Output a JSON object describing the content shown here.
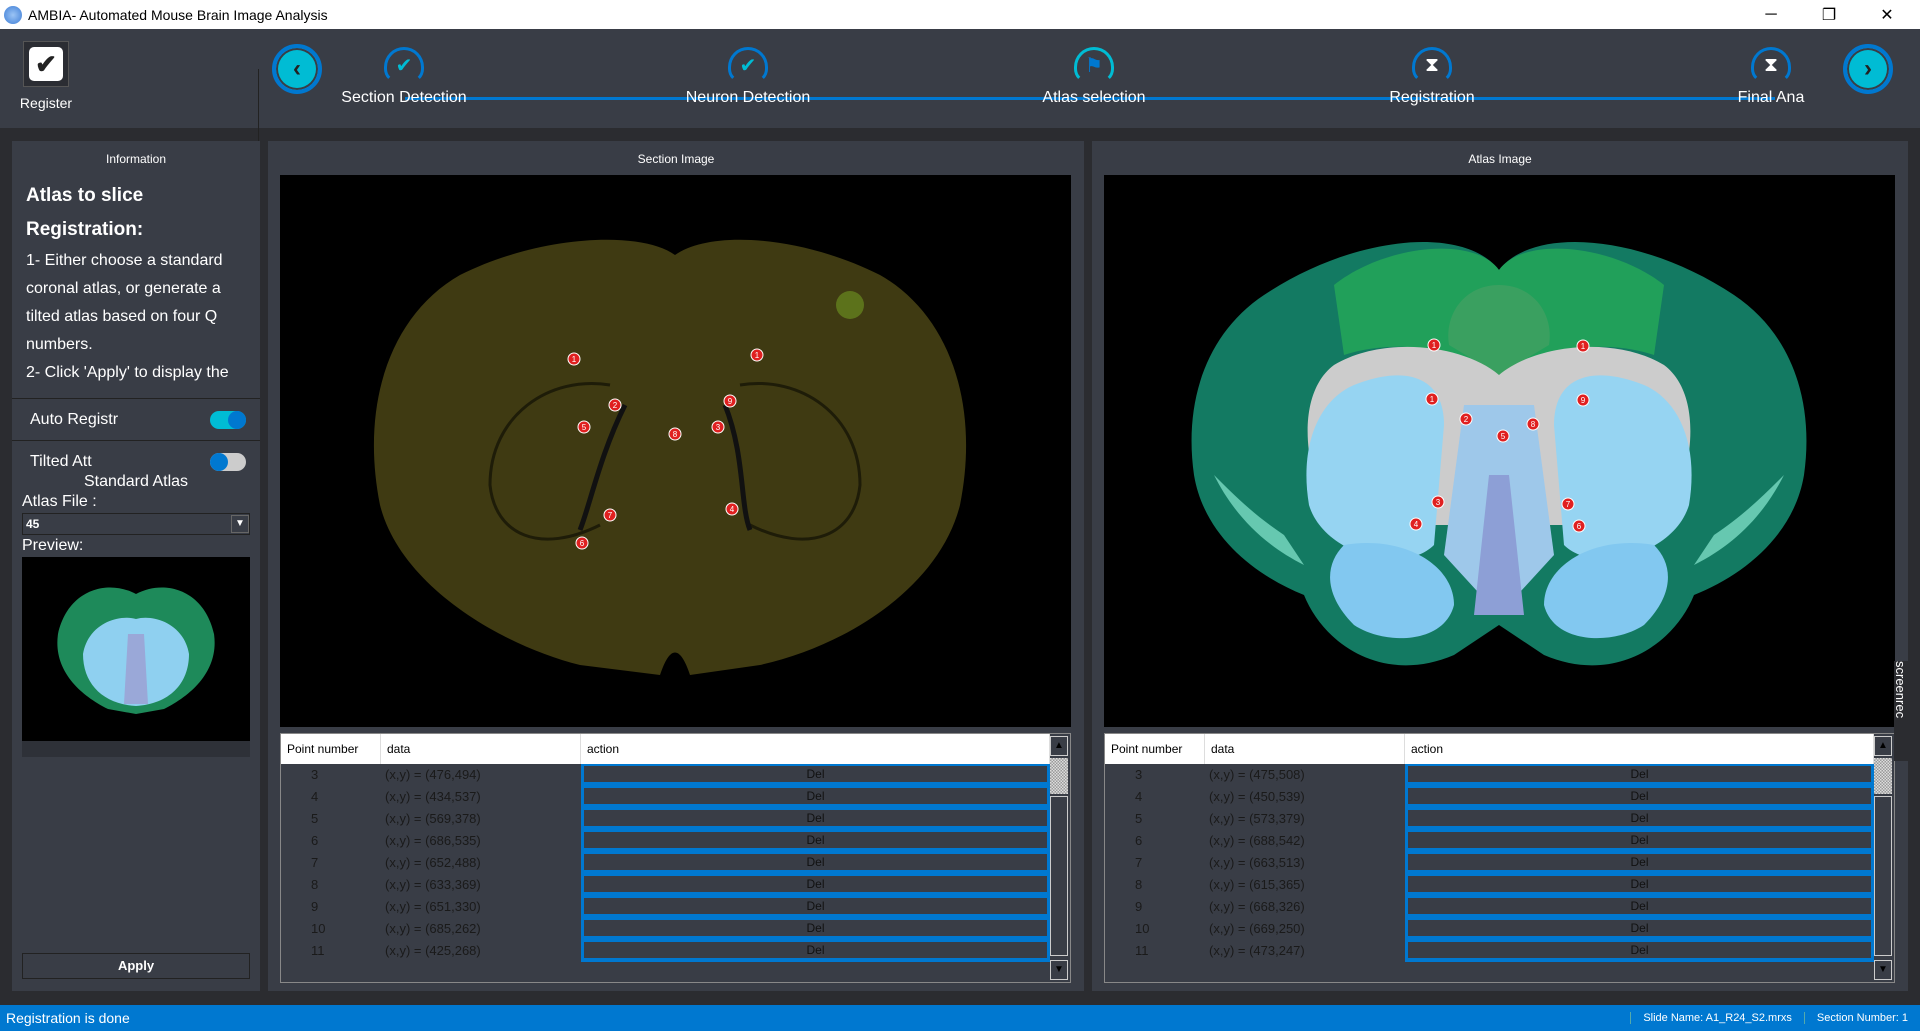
{
  "window": {
    "title": "AMBIA- Automated Mouse Brain Image Analysis",
    "minimize": "─",
    "restore": "❐",
    "close": "✕"
  },
  "toolbar": {
    "register_label": "Register",
    "steps": [
      {
        "label": "Section Detection",
        "state": "done"
      },
      {
        "label": "Neuron Detection",
        "state": "done"
      },
      {
        "label": "Atlas selection",
        "state": "active"
      },
      {
        "label": "Registration",
        "state": "pending"
      },
      {
        "label": "Final Ana",
        "state": "pending"
      }
    ],
    "back_icon": "‹",
    "forward_icon": "›"
  },
  "info": {
    "title": "Information",
    "heading1": "Atlas to slice",
    "heading2": "Registration:",
    "text": "1- Either choose a standard coronal atlas, or generate a tilted atlas based on four Q numbers.",
    "clipped": "2- Click 'Apply' to display the",
    "auto_label": "Auto Registr",
    "auto_on": true,
    "tilted_label": "Tilted Att",
    "tilted_on": false,
    "atlas_mode": "Standard Atlas",
    "atlas_file_label": "Atlas File :",
    "atlas_file_value": "45",
    "preview_label": "Preview:",
    "apply_label": "Apply"
  },
  "section": {
    "title": "Section Image",
    "markers": [
      "1",
      "1",
      "2",
      "9",
      "5",
      "8",
      "3",
      "7",
      "4",
      "6"
    ]
  },
  "atlas": {
    "title": "Atlas Image",
    "markers": [
      "1",
      "1",
      "1",
      "9",
      "2",
      "8",
      "5",
      "3",
      "7",
      "4",
      "6"
    ]
  },
  "table_headers": [
    "Point number",
    "data",
    "action"
  ],
  "section_table": [
    {
      "n": "3",
      "d": "(x,y) = (476,494)",
      "a": "Del"
    },
    {
      "n": "4",
      "d": "(x,y) = (434,537)",
      "a": "Del"
    },
    {
      "n": "5",
      "d": "(x,y) = (569,378)",
      "a": "Del"
    },
    {
      "n": "6",
      "d": "(x,y) = (686,535)",
      "a": "Del"
    },
    {
      "n": "7",
      "d": "(x,y) = (652,488)",
      "a": "Del"
    },
    {
      "n": "8",
      "d": "(x,y) = (633,369)",
      "a": "Del"
    },
    {
      "n": "9",
      "d": "(x,y) = (651,330)",
      "a": "Del"
    },
    {
      "n": "10",
      "d": "(x,y) = (685,262)",
      "a": "Del"
    },
    {
      "n": "11",
      "d": "(x,y) = (425,268)",
      "a": "Del"
    }
  ],
  "atlas_table": [
    {
      "n": "3",
      "d": "(x,y) = (475,508)",
      "a": "Del"
    },
    {
      "n": "4",
      "d": "(x,y) = (450,539)",
      "a": "Del"
    },
    {
      "n": "5",
      "d": "(x,y) = (573,379)",
      "a": "Del"
    },
    {
      "n": "6",
      "d": "(x,y) = (688,542)",
      "a": "Del"
    },
    {
      "n": "7",
      "d": "(x,y) = (663,513)",
      "a": "Del"
    },
    {
      "n": "8",
      "d": "(x,y) = (615,365)",
      "a": "Del"
    },
    {
      "n": "9",
      "d": "(x,y) = (668,326)",
      "a": "Del"
    },
    {
      "n": "10",
      "d": "(x,y) = (669,250)",
      "a": "Del"
    },
    {
      "n": "11",
      "d": "(x,y) = (473,247)",
      "a": "Del"
    }
  ],
  "status": {
    "message": "Registration is done",
    "slide_name": "Slide Name: A1_R24_S2.mrxs",
    "section_number": "Section Number: 1"
  },
  "watermark": "screenrec",
  "colors": {
    "accent": "#0078d0",
    "cyan": "#00bcd4",
    "panel": "#393d46"
  }
}
